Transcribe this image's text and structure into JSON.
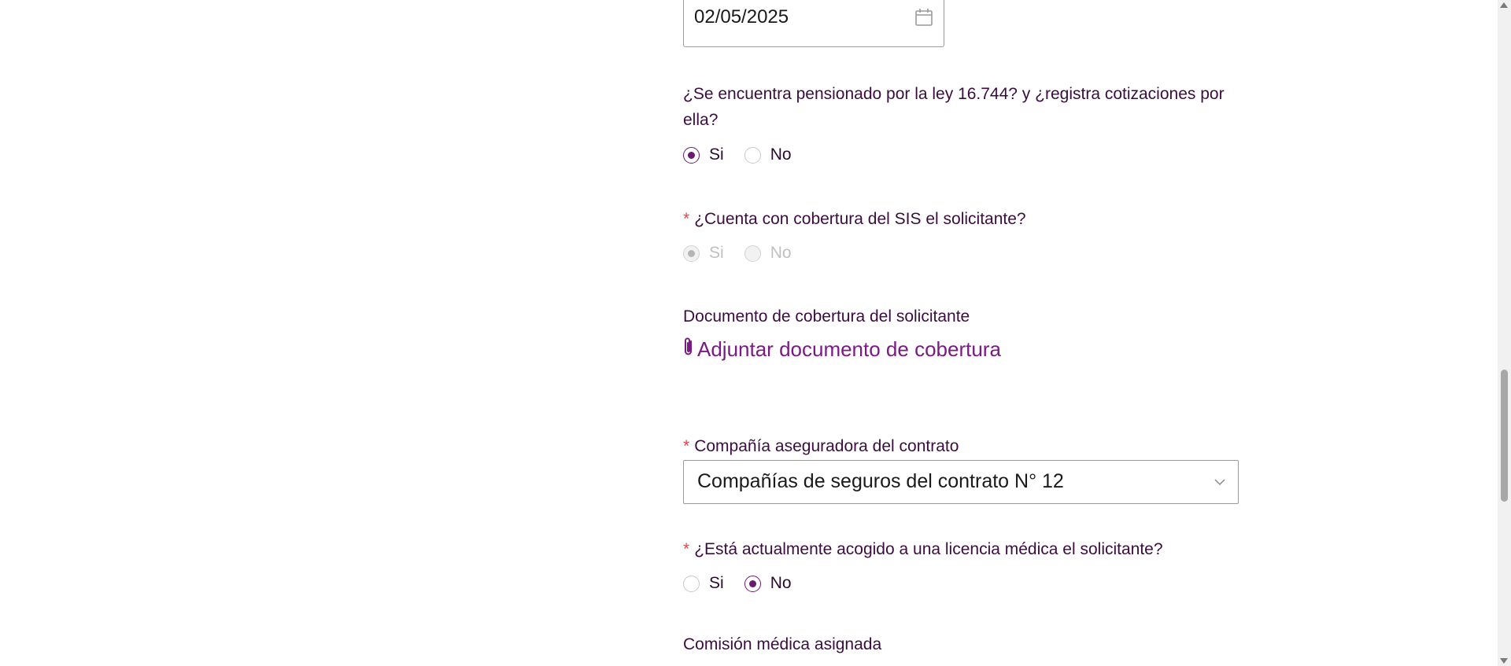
{
  "date_field": {
    "value": "02/05/2025",
    "icon": "calendar-icon"
  },
  "q_pension": {
    "label": "¿Se encuentra pensionado por la ley 16.744? y ¿registra cotizaciones por ella?",
    "options": [
      "Si",
      "No"
    ],
    "selected": "Si"
  },
  "q_sis": {
    "required_mark": "*",
    "label": "¿Cuenta con cobertura del SIS el solicitante?",
    "options": [
      "Si",
      "No"
    ],
    "selected": "Si",
    "disabled": true
  },
  "coverage_doc": {
    "label": "Documento de cobertura del solicitante",
    "attach_label": "Adjuntar documento de cobertura",
    "icon": "paperclip-icon"
  },
  "insurer": {
    "required_mark": "*",
    "label": "Compañía aseguradora del contrato",
    "value": "Compañías de seguros del contrato N° 12",
    "icon": "chevron-down-icon"
  },
  "q_license": {
    "required_mark": "*",
    "label": "¿Está actualmente acogido a una licencia médica el solicitante?",
    "options": [
      "Si",
      "No"
    ],
    "selected": "No"
  },
  "commission": {
    "label": "Comisión médica asignada"
  },
  "colors": {
    "accent": "#6a1b6e",
    "link": "#7a1a84",
    "required": "#e0464a",
    "text": "#3b0d3f"
  }
}
